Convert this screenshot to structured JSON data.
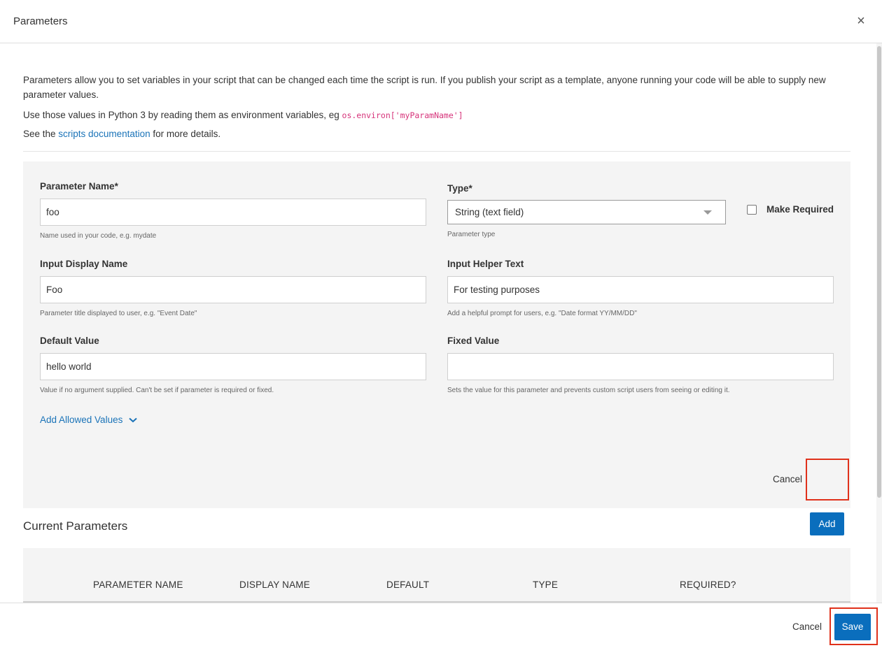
{
  "dialog": {
    "title": "Parameters",
    "close_icon": "×"
  },
  "intro": {
    "line1": "Parameters allow you to set variables in your script that can be changed each time the script is run. If you publish your script as a template, anyone running your code will be able to supply new parameter values.",
    "line2_prefix": "Use those values in Python 3 by reading them as environment variables, eg ",
    "line2_code": "os.environ['myParamName']",
    "line3_prefix": "See the ",
    "line3_link": "scripts documentation",
    "line3_suffix": " for more details."
  },
  "form": {
    "param_name": {
      "label": "Parameter Name*",
      "value": "foo",
      "help": "Name used in your code, e.g. mydate"
    },
    "type": {
      "label": "Type*",
      "value": "String (text field)",
      "help": "Parameter type"
    },
    "make_required": {
      "label": "Make Required",
      "checked": false
    },
    "display_name": {
      "label": "Input Display Name",
      "value": "Foo",
      "help": "Parameter title displayed to user, e.g. \"Event Date\""
    },
    "helper_text": {
      "label": "Input Helper Text",
      "value": "For testing purposes",
      "help": "Add a helpful prompt for users, e.g. \"Date format YY/MM/DD\""
    },
    "default_value": {
      "label": "Default Value",
      "value": "hello world",
      "help": "Value if no argument supplied. Can't be set if parameter is required or fixed."
    },
    "fixed_value": {
      "label": "Fixed Value",
      "value": "",
      "help": "Sets the value for this parameter and prevents custom script users from seeing or editing it."
    },
    "allowed_values_link": "Add Allowed Values",
    "chevron_icon": "chevron-down-icon",
    "cancel_label": "Cancel",
    "add_label": "Add"
  },
  "current_parameters": {
    "title": "Current Parameters",
    "columns": [
      "PARAMETER NAME",
      "DISPLAY NAME",
      "DEFAULT",
      "TYPE",
      "REQUIRED?"
    ]
  },
  "footer": {
    "cancel_label": "Cancel",
    "save_label": "Save"
  },
  "colors": {
    "primary": "#0a6ebd",
    "link": "#1a73b8",
    "highlight": "#e0311b",
    "code": "#d6337a"
  }
}
